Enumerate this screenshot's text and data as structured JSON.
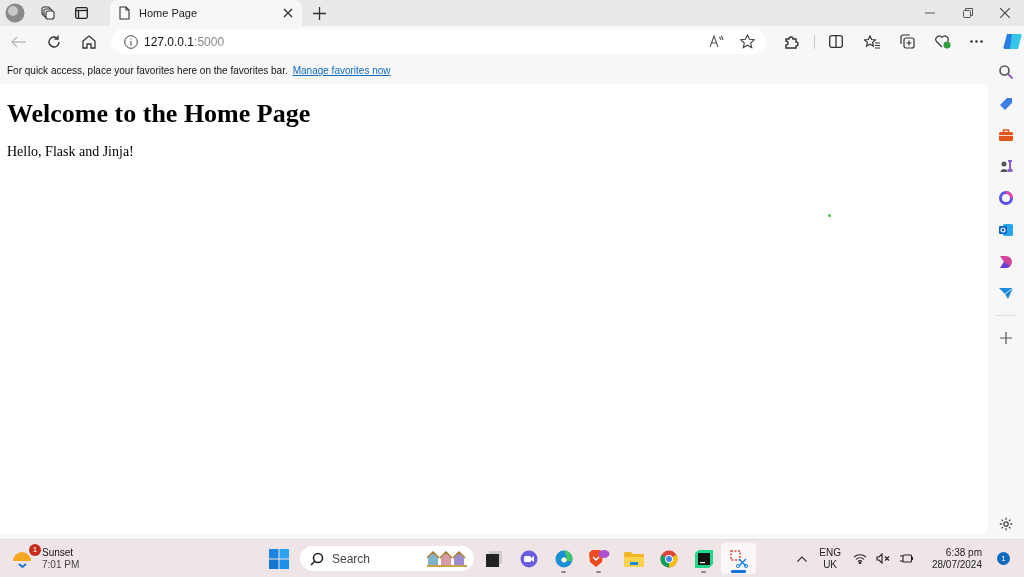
{
  "tab": {
    "title": "Home Page",
    "selected": true
  },
  "address": {
    "host": "127.0.0.1",
    "port": ":5000"
  },
  "favorites_bar": {
    "message": "For quick access, place your favorites here on the favorites bar.",
    "link": "Manage favorites now"
  },
  "page": {
    "heading": "Welcome to the Home Page",
    "paragraph": "Hello, Flask and Jinja!"
  },
  "taskbar": {
    "weather": {
      "title": "Sunset",
      "time": "7:01 PM",
      "badge": "1"
    },
    "search": {
      "placeholder": "Search"
    },
    "apps": [
      {
        "kind": "taskview",
        "running": false,
        "selected": false
      },
      {
        "kind": "meet",
        "running": false,
        "selected": false
      },
      {
        "kind": "edge",
        "running": true,
        "selected": false
      },
      {
        "kind": "brave",
        "running": true,
        "selected": false
      },
      {
        "kind": "files",
        "running": false,
        "selected": false
      },
      {
        "kind": "chrome",
        "running": false,
        "selected": false
      },
      {
        "kind": "pycharm",
        "running": true,
        "selected": false
      },
      {
        "kind": "snip",
        "running": true,
        "selected": true
      }
    ],
    "language": {
      "line1": "ENG",
      "line2": "UK"
    },
    "clock": {
      "time": "6:38 pm",
      "date": "28/07/2024"
    },
    "notifications": "1"
  }
}
